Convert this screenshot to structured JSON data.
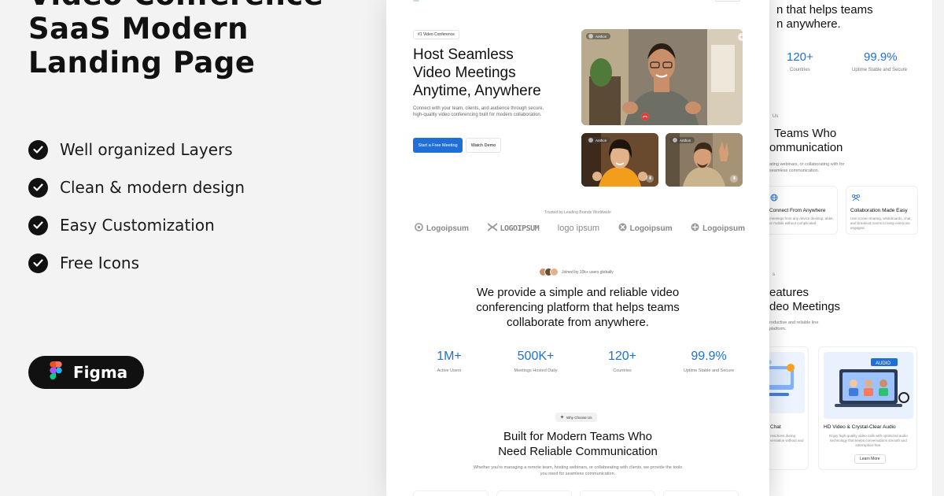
{
  "promo": {
    "title_lines": [
      "Video Conference",
      "SaaS Modern",
      "Landing Page"
    ],
    "features": [
      "Well organized Layers",
      "Clean & modern design",
      "Easy Customization",
      "Free Icons"
    ],
    "badge": "Figma"
  },
  "hero": {
    "pill": "#1 Video Conference",
    "title_lines": [
      "Host Seamless",
      "Video Meetings",
      "Anytime, Anywhere"
    ],
    "description": "Connect with your team, clients, and audience through secure, high-quality video conferencing built for modern collaboration.",
    "primary_cta": "Start a Free Meeting",
    "secondary_cta": "Watch Demo",
    "participants": [
      "Anthon",
      "Anthon",
      "Anthon"
    ]
  },
  "trusted": {
    "caption": "Trusted by Leading Brands Worldwide",
    "logos": [
      "Logoipsum",
      "LOGOIPSUM",
      "logo ipsum",
      "Logoipsum",
      "Logoipsum"
    ]
  },
  "mission": {
    "joined": "Joined by 10k+ users globally",
    "lines": [
      "We provide a simple and reliable video",
      "conferencing platform that helps teams",
      "collaborate from anywhere."
    ]
  },
  "stats": [
    {
      "value": "1M+",
      "label": "Active Users"
    },
    {
      "value": "500K+",
      "label": "Meetings Hosted Daily"
    },
    {
      "value": "120+",
      "label": "Countries"
    },
    {
      "value": "99.9%",
      "label": "Uptime Stable and Secure"
    }
  ],
  "why": {
    "pill": "Why Choose Us",
    "title_lines": [
      "Built for Modern Teams Who",
      "Need Reliable Communication"
    ],
    "description": "Whether you're managing a remote team, hosting webinars, or collaborating with clients, we provide the tools you need for seamless communication."
  },
  "back_page": {
    "mission_lines": [
      "n that helps teams",
      "n anywhere."
    ],
    "stats": [
      {
        "value": "120+",
        "label": "Countries"
      },
      {
        "value": "99.9%",
        "label": "Uptime Stable and Secure"
      }
    ],
    "pill_fragment": "Us",
    "why_lines": [
      "Teams Who",
      "ommunication"
    ],
    "why_desc": "ating webinars, or collaborating with for seamless communication.",
    "card1_title": "Connect From Anywhere",
    "card1_desc": "meetings from any device desktop, ablet, or mobile without complicated",
    "card2_title": "Collaboration Made Easy",
    "card2_desc": "Use screen sharing, whiteboards, chat, and breakout rooms to keep everyone engaged.",
    "features_pill": "s",
    "features_lines": [
      "eatures",
      "deo Meetings"
    ],
    "features_desc": "roductive and reliable line platform.",
    "card3_title": "Chat",
    "card3_desc": "reactions during versation without and",
    "card4_title": "HD Video & Crystal-Clear Audio",
    "card4_desc": "Enjoy high-quality video calls with optimized audio technology that keeps conversations smooth and interruption-free.",
    "card4_image_text": "AUDIO",
    "card4_button": "Learn More"
  },
  "colors": {
    "accent": "#1f6fd6",
    "dark": "#111111",
    "end_call": "#e53935"
  }
}
